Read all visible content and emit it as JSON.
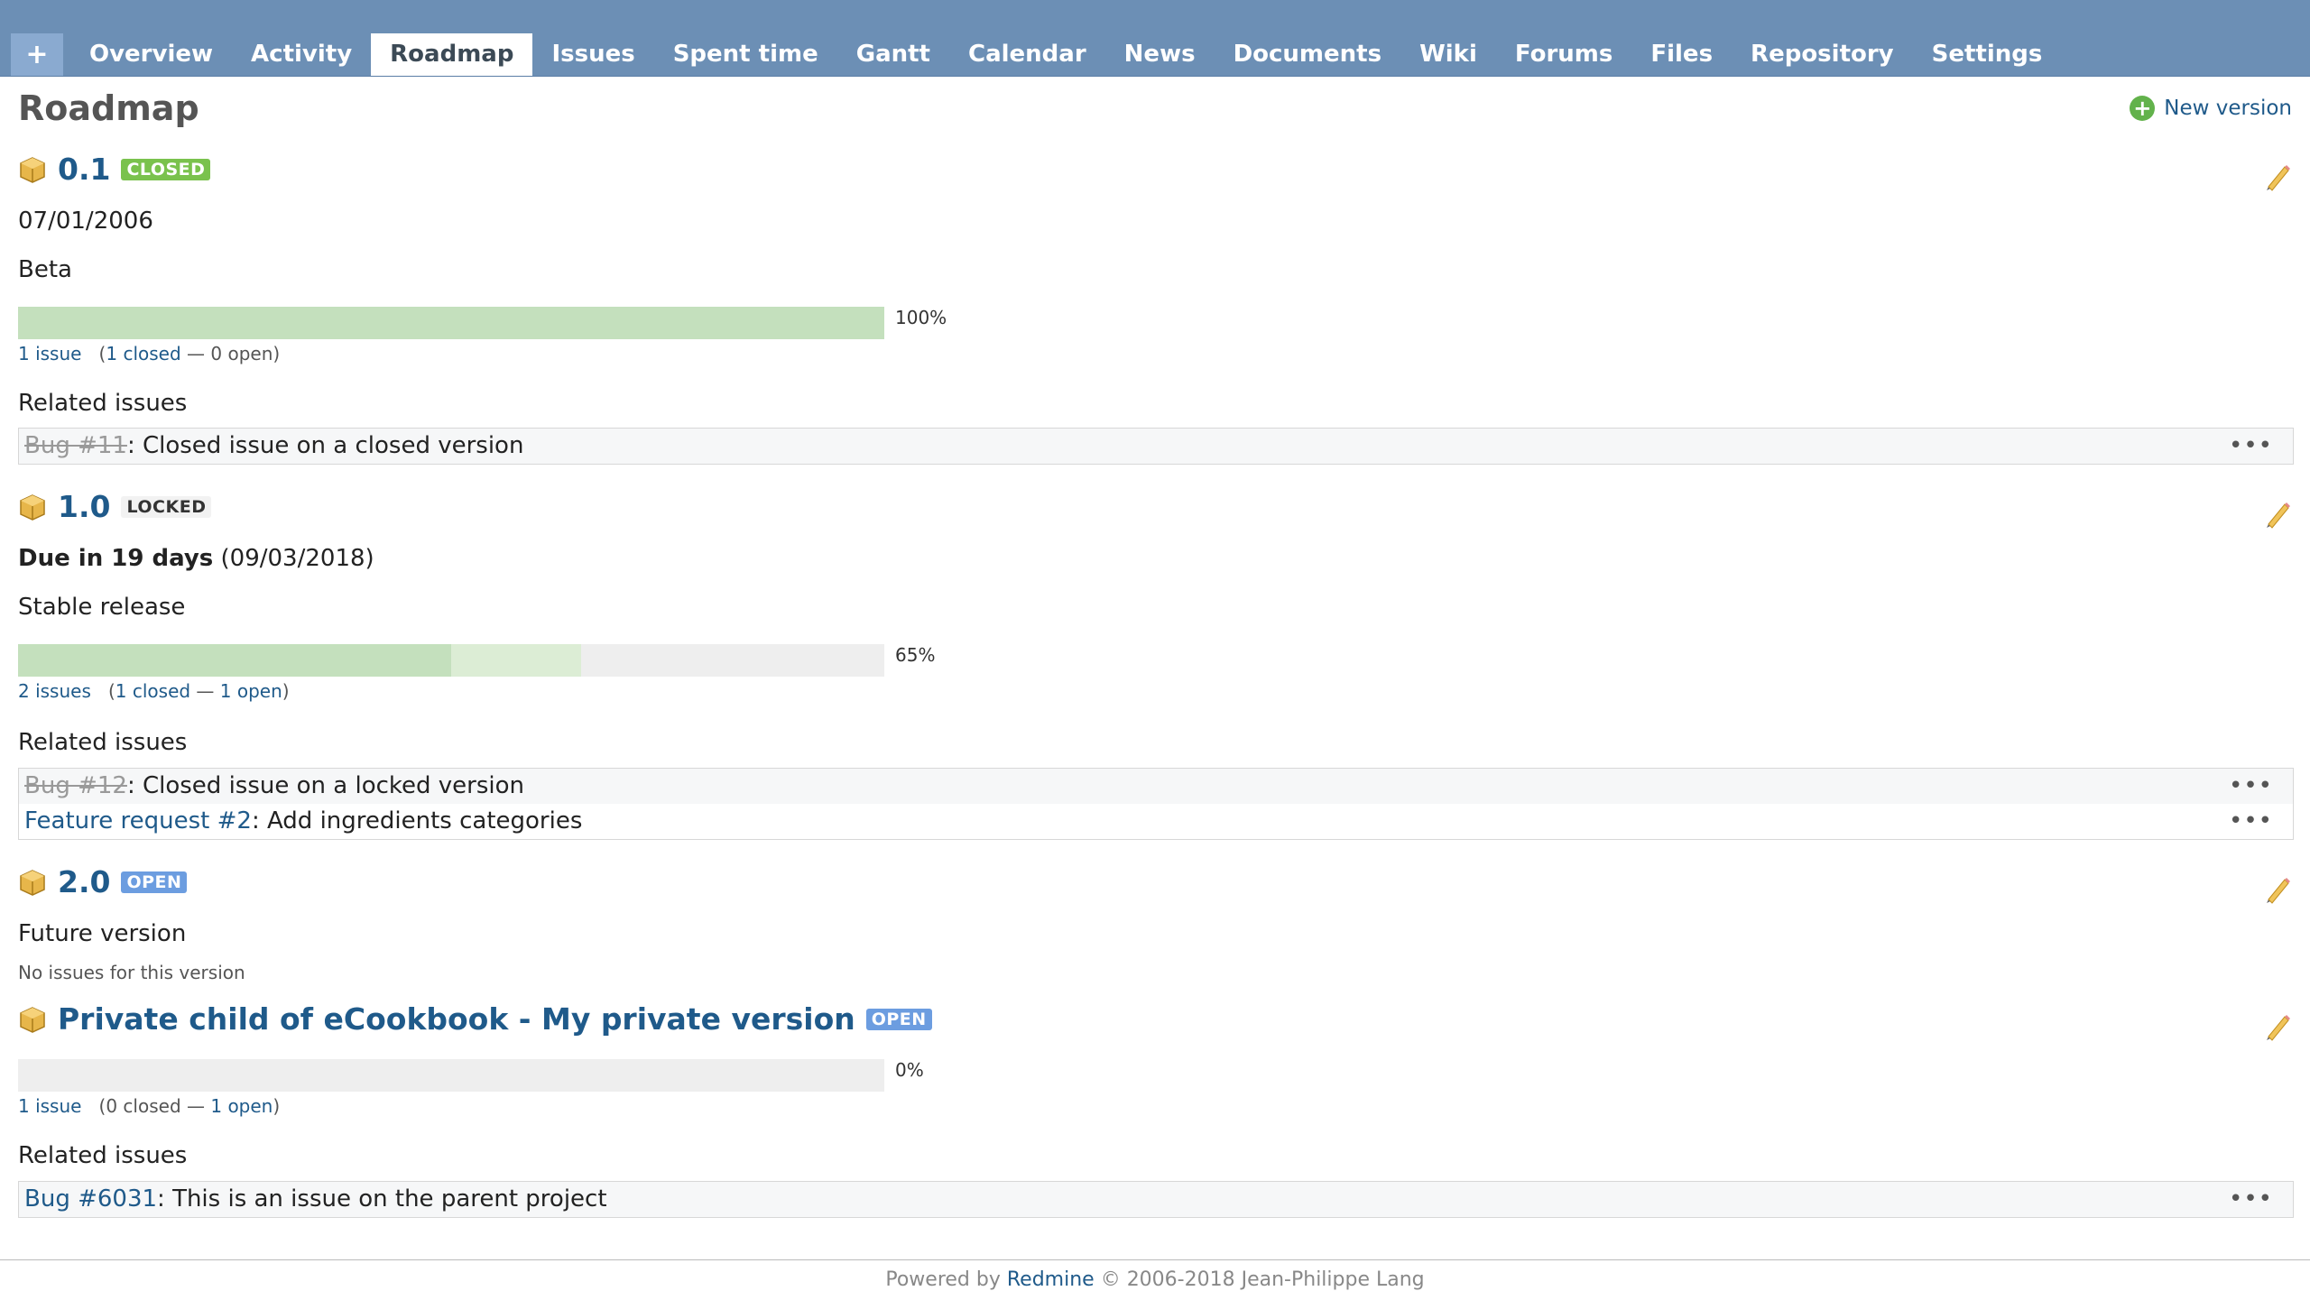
{
  "tabs": [
    {
      "label": "+"
    },
    {
      "label": "Overview"
    },
    {
      "label": "Activity"
    },
    {
      "label": "Roadmap"
    },
    {
      "label": "Issues"
    },
    {
      "label": "Spent time"
    },
    {
      "label": "Gantt"
    },
    {
      "label": "Calendar"
    },
    {
      "label": "News"
    },
    {
      "label": "Documents"
    },
    {
      "label": "Wiki"
    },
    {
      "label": "Forums"
    },
    {
      "label": "Files"
    },
    {
      "label": "Repository"
    },
    {
      "label": "Settings"
    }
  ],
  "page": {
    "title": "Roadmap",
    "new_version_label": "New version"
  },
  "versions": [
    {
      "name": "0.1",
      "status": "CLOSED",
      "date_line": "07/01/2006",
      "description": "Beta",
      "closed_pct": 100,
      "done_pct": 0,
      "pct_label": "100%",
      "issues_link": "1 issue",
      "stats_open_paren": "(",
      "closed_link": "1 closed",
      "sep": " — ",
      "open_text": "0 open)",
      "related_label": "Related issues",
      "related": [
        {
          "ref": "Bug #11",
          "title": ": Closed issue on a closed version",
          "closed": true
        }
      ]
    },
    {
      "name": "1.0",
      "status": "LOCKED",
      "due_bold": "Due in 19 days",
      "due_date": " (09/03/2018)",
      "description": "Stable release",
      "closed_pct": 50,
      "done_pct": 15,
      "pct_label": "65%",
      "issues_link": "2 issues",
      "stats_open_paren": "(",
      "closed_link": "1 closed",
      "sep": " — ",
      "open_link": "1 open",
      "close_paren": ")",
      "related_label": "Related issues",
      "related": [
        {
          "ref": "Bug #12",
          "title": ": Closed issue on a locked version",
          "closed": true
        },
        {
          "ref": "Feature request #2",
          "title": ": Add ingredients categories",
          "closed": false
        }
      ]
    },
    {
      "name": "2.0",
      "status": "OPEN",
      "description": "Future version",
      "no_issues": "No issues for this version"
    },
    {
      "name": "Private child of eCookbook - My private version",
      "status": "OPEN",
      "closed_pct": 0,
      "done_pct": 0,
      "pct_label": "0%",
      "issues_link": "1 issue",
      "stats_open_paren": "(0 closed",
      "sep": " — ",
      "open_link": "1 open",
      "close_paren": ")",
      "related_label": "Related issues",
      "related": [
        {
          "ref": "Bug #6031",
          "title": ": This is an issue on the parent project",
          "closed": false
        }
      ]
    }
  ],
  "footer": {
    "prefix": "Powered by ",
    "link": "Redmine",
    "suffix": " © 2006-2018 Jean-Philippe Lang"
  },
  "colors": {
    "header": "#6c8fb5",
    "link": "#1f5a8a",
    "done": "#c4e0bd",
    "closed_badge": "#7ac24d",
    "open_badge": "#6c9de0"
  }
}
